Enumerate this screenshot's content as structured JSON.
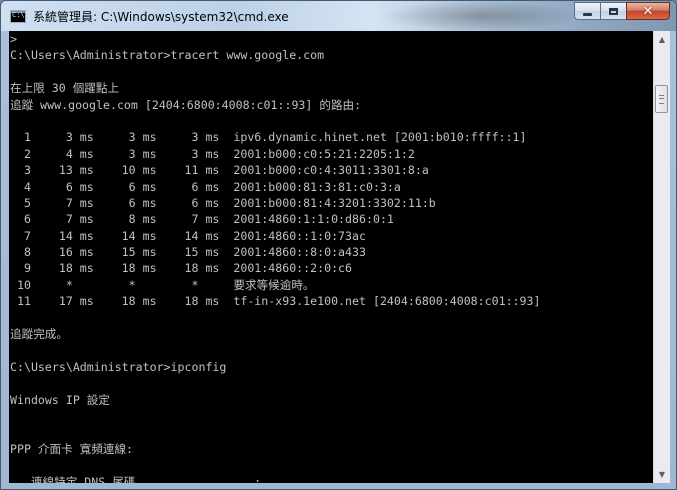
{
  "window": {
    "title": "系統管理員: C:\\Windows\\system32\\cmd.exe",
    "icon_glyph": "C:\\",
    "buttons": {
      "minimize": "minimize-icon",
      "maximize": "maximize-icon",
      "close": "close-icon"
    }
  },
  "console": {
    "lines": [
      ">",
      "C:\\Users\\Administrator>tracert www.google.com",
      "",
      "在上限 30 個躍點上",
      "追蹤 www.google.com [2404:6800:4008:c01::93] 的路由:",
      "",
      "  1     3 ms     3 ms     3 ms  ipv6.dynamic.hinet.net [2001:b010:ffff::1]",
      "  2     4 ms     3 ms     3 ms  2001:b000:c0:5:21:2205:1:2",
      "  3    13 ms    10 ms    11 ms  2001:b000:c0:4:3011:3301:8:a",
      "  4     6 ms     6 ms     6 ms  2001:b000:81:3:81:c0:3:a",
      "  5     7 ms     6 ms     6 ms  2001:b000:81:4:3201:3302:11:b",
      "  6     7 ms     8 ms     7 ms  2001:4860:1:1:0:d86:0:1",
      "  7    14 ms    14 ms    14 ms  2001:4860::1:0:73ac",
      "  8    16 ms    15 ms    15 ms  2001:4860::8:0:a433",
      "  9    18 ms    18 ms    18 ms  2001:4860::2:0:c6",
      " 10     *        *        *     要求等候逾時。",
      " 11    17 ms    18 ms    18 ms  tf-in-x93.1e100.net [2404:6800:4008:c01::93]",
      "",
      "追蹤完成。",
      "",
      "C:\\Users\\Administrator>ipconfig",
      "",
      "Windows IP 設定",
      "",
      "",
      "PPP 介面卡 寬頻連線:",
      "",
      "   連線特定 DNS 尾碼 . . . . . . . . :"
    ]
  },
  "scrollbar": {
    "up_arrow": "▲",
    "down_arrow": "▼"
  }
}
